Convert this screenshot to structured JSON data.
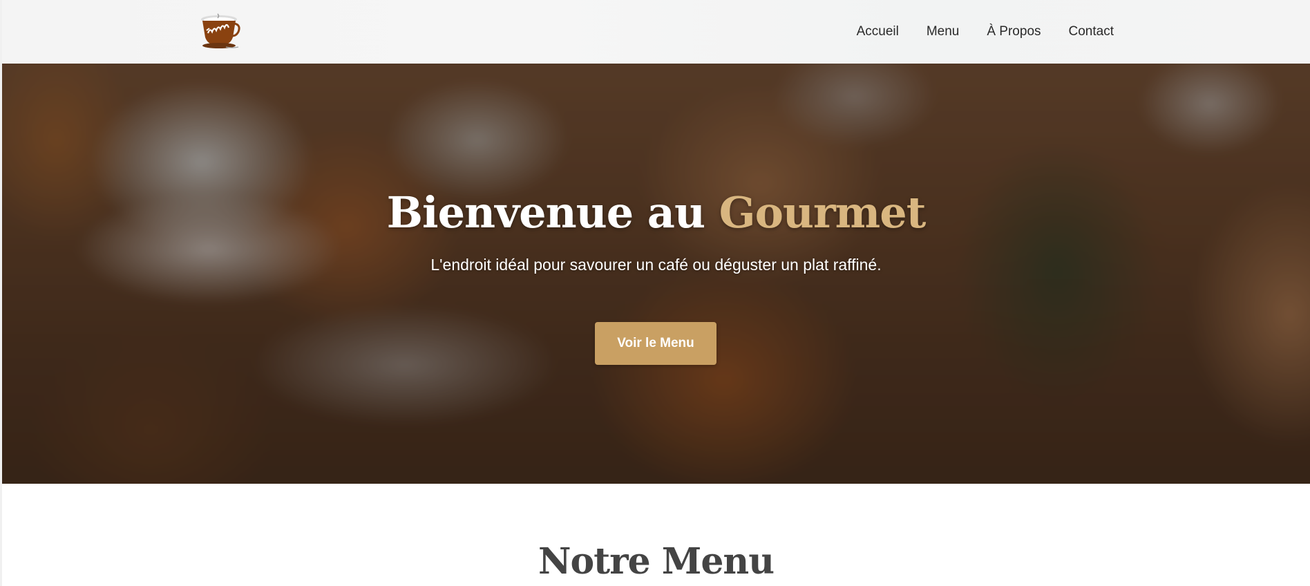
{
  "header": {
    "logo_icon": "coffee-cup-logo",
    "nav": [
      {
        "label": "Accueil"
      },
      {
        "label": "Menu"
      },
      {
        "label": "À Propos"
      },
      {
        "label": "Contact"
      }
    ]
  },
  "hero": {
    "title_prefix": "Bienvenue au ",
    "title_accent": "Gourmet",
    "subtitle": "L'endroit idéal pour savourer un café ou déguster un plat raffiné.",
    "button_label": "Voir le Menu"
  },
  "menu_section": {
    "title": "Notre Menu"
  },
  "colors": {
    "accent": "#c9a063",
    "title_accent": "#d9b680",
    "nav_text": "#2a2a2a",
    "section_title": "#444444"
  }
}
